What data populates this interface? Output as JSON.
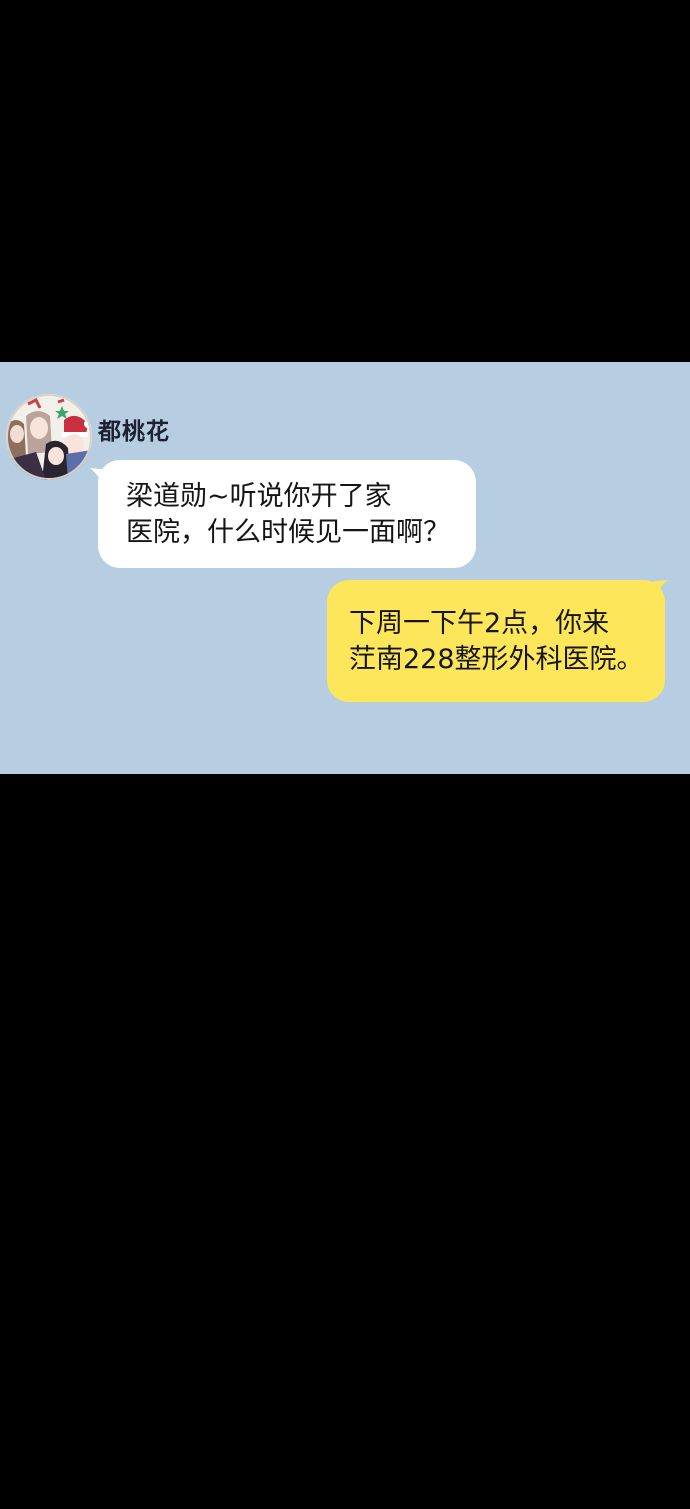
{
  "chat": {
    "contact": {
      "name": "都桃花",
      "avatar_icon": "group-photo-avatar"
    },
    "messages": [
      {
        "direction": "incoming",
        "lines": [
          "梁道勋~听说你开了家",
          "医院，什么时候见一面啊？"
        ],
        "bubble_color": "#ffffff"
      },
      {
        "direction": "outgoing",
        "lines": [
          "下周一下午2点，你来",
          "茳南228整形外科医院。"
        ],
        "bubble_color": "#fee65a"
      }
    ],
    "background_color": "#b7cde2"
  }
}
